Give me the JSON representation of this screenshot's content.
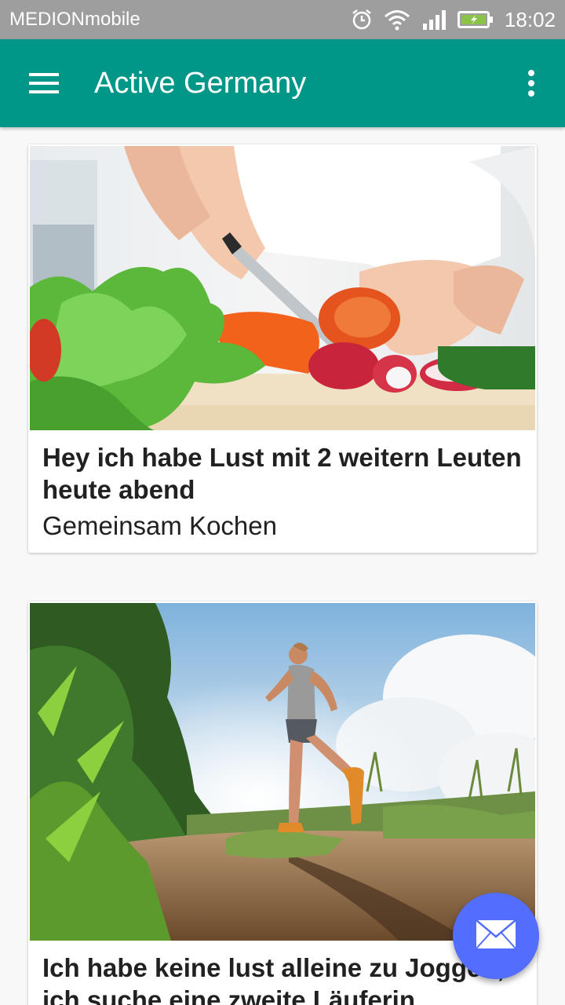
{
  "statusbar": {
    "carrier": "MEDIONmobile",
    "time": "18:02",
    "icons": [
      "alarm-icon",
      "wifi-icon",
      "signal-icon",
      "battery-charging-icon"
    ]
  },
  "appbar": {
    "title": "Active Germany",
    "menu_icon": "hamburger-menu-icon",
    "more_icon": "more-vert-icon",
    "color": "#009688"
  },
  "cards": [
    {
      "image": "cooking-vegetables-photo",
      "headline": "Hey ich habe Lust mit 2 weitern Leuten heute abend",
      "subhead": "Gemeinsam Kochen"
    },
    {
      "image": "jogging-runner-photo",
      "headline": "Ich habe keine lust alleine zu Joggen, ich suche eine zweite Läuferin"
    }
  ],
  "fab": {
    "icon": "mail-icon",
    "color": "#536dfe"
  }
}
